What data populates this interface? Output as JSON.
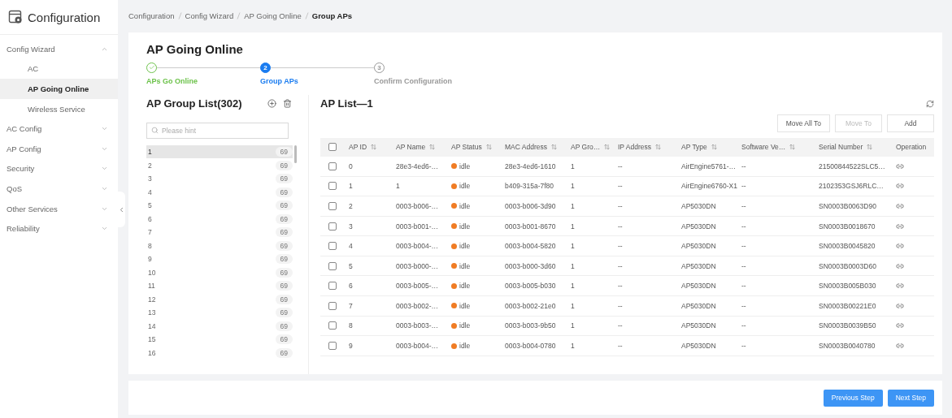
{
  "sidebar": {
    "title": "Configuration",
    "items": [
      {
        "label": "Config Wizard",
        "expanded": true,
        "selected": false,
        "children": [
          {
            "label": "AC",
            "selected": false
          },
          {
            "label": "AP Going Online",
            "selected": true
          },
          {
            "label": "Wireless Service",
            "selected": false
          }
        ]
      },
      {
        "label": "AC Config",
        "expanded": false,
        "selected": false
      },
      {
        "label": "AP Config",
        "expanded": false,
        "selected": false
      },
      {
        "label": "Security",
        "expanded": false,
        "selected": false
      },
      {
        "label": "QoS",
        "expanded": false,
        "selected": false
      },
      {
        "label": "Other Services",
        "expanded": false,
        "selected": false
      },
      {
        "label": "Reliability",
        "expanded": false,
        "selected": false
      }
    ]
  },
  "breadcrumb": [
    {
      "label": "Configuration",
      "current": false
    },
    {
      "label": "Config Wizard",
      "current": false
    },
    {
      "label": "AP Going Online",
      "current": false
    },
    {
      "label": "Group APs",
      "current": true
    }
  ],
  "page_title": "AP Going Online",
  "steps": [
    {
      "label": "APs Go Online",
      "completed": true,
      "selected": false
    },
    {
      "number": "2",
      "label": "Group APs",
      "completed": false,
      "selected": true
    },
    {
      "number": "3",
      "label": "Confirm Configuration",
      "completed": false,
      "selected": false
    }
  ],
  "group_list": {
    "title": "AP Group List(302)",
    "search_placeholder": "Please hint",
    "items": [
      {
        "name": "1",
        "count": "69",
        "selected": true
      },
      {
        "name": "2",
        "count": "69",
        "selected": false
      },
      {
        "name": "3",
        "count": "69",
        "selected": false
      },
      {
        "name": "4",
        "count": "69",
        "selected": false
      },
      {
        "name": "5",
        "count": "69",
        "selected": false
      },
      {
        "name": "6",
        "count": "69",
        "selected": false
      },
      {
        "name": "7",
        "count": "69",
        "selected": false
      },
      {
        "name": "8",
        "count": "69",
        "selected": false
      },
      {
        "name": "9",
        "count": "69",
        "selected": false
      },
      {
        "name": "10",
        "count": "69",
        "selected": false
      },
      {
        "name": "11",
        "count": "69",
        "selected": false
      },
      {
        "name": "12",
        "count": "69",
        "selected": false
      },
      {
        "name": "13",
        "count": "69",
        "selected": false
      },
      {
        "name": "14",
        "count": "69",
        "selected": false
      },
      {
        "name": "15",
        "count": "69",
        "selected": false
      },
      {
        "name": "16",
        "count": "69",
        "selected": false
      }
    ]
  },
  "ap_list": {
    "title": "AP List—1",
    "buttons": [
      {
        "label": "Move All To",
        "disabled": false
      },
      {
        "label": "Move To",
        "disabled": true
      },
      {
        "label": "Add",
        "disabled": false
      }
    ],
    "select_all": {
      "checked": false
    },
    "columns": [
      {
        "label": "AP ID",
        "sortable": true
      },
      {
        "label": "AP Name",
        "sortable": true
      },
      {
        "label": "AP Status",
        "sortable": true
      },
      {
        "label": "MAC Address",
        "sortable": true
      },
      {
        "label": "AP Gro…",
        "sortable": true
      },
      {
        "label": "IP Address",
        "sortable": true
      },
      {
        "label": "AP Type",
        "sortable": true
      },
      {
        "label": "Software Ve…",
        "sortable": true
      },
      {
        "label": "Serial Number",
        "sortable": true
      },
      {
        "label": "Operation",
        "sortable": false
      }
    ],
    "rows": [
      {
        "checked": false,
        "id": "0",
        "name": "28e3-4ed6-…",
        "status": "idle",
        "color": "#f07c24",
        "mac": "28e3-4ed6-1610",
        "group": "1",
        "ip": "--",
        "type": "AirEngine5761-…",
        "software": "--",
        "serial": "21500844522SLC5…"
      },
      {
        "checked": false,
        "id": "1",
        "name": "1",
        "status": "idle",
        "color": "#f07c24",
        "mac": "b409-315a-7f80",
        "group": "1",
        "ip": "--",
        "type": "AirEngine6760-X1",
        "software": "--",
        "serial": "2102353GSJ6RLC…"
      },
      {
        "checked": false,
        "id": "2",
        "name": "0003-b006-…",
        "status": "idle",
        "color": "#f07c24",
        "mac": "0003-b006-3d90",
        "group": "1",
        "ip": "--",
        "type": "AP5030DN",
        "software": "--",
        "serial": "SN0003B0063D90"
      },
      {
        "checked": false,
        "id": "3",
        "name": "0003-b001-…",
        "status": "idle",
        "color": "#f07c24",
        "mac": "0003-b001-8670",
        "group": "1",
        "ip": "--",
        "type": "AP5030DN",
        "software": "--",
        "serial": "SN0003B0018670"
      },
      {
        "checked": false,
        "id": "4",
        "name": "0003-b004-…",
        "status": "idle",
        "color": "#f07c24",
        "mac": "0003-b004-5820",
        "group": "1",
        "ip": "--",
        "type": "AP5030DN",
        "software": "--",
        "serial": "SN0003B0045820"
      },
      {
        "checked": false,
        "id": "5",
        "name": "0003-b000-…",
        "status": "idle",
        "color": "#f07c24",
        "mac": "0003-b000-3d60",
        "group": "1",
        "ip": "--",
        "type": "AP5030DN",
        "software": "--",
        "serial": "SN0003B0003D60"
      },
      {
        "checked": false,
        "id": "6",
        "name": "0003-b005-…",
        "status": "idle",
        "color": "#f07c24",
        "mac": "0003-b005-b030",
        "group": "1",
        "ip": "--",
        "type": "AP5030DN",
        "software": "--",
        "serial": "SN0003B005B030"
      },
      {
        "checked": false,
        "id": "7",
        "name": "0003-b002-…",
        "status": "idle",
        "color": "#f07c24",
        "mac": "0003-b002-21e0",
        "group": "1",
        "ip": "--",
        "type": "AP5030DN",
        "software": "--",
        "serial": "SN0003B00221E0"
      },
      {
        "checked": false,
        "id": "8",
        "name": "0003-b003-…",
        "status": "idle",
        "color": "#f07c24",
        "mac": "0003-b003-9b50",
        "group": "1",
        "ip": "--",
        "type": "AP5030DN",
        "software": "--",
        "serial": "SN0003B0039B50"
      },
      {
        "checked": false,
        "id": "9",
        "name": "0003-b004-…",
        "status": "idle",
        "color": "#f07c24",
        "mac": "0003-b004-0780",
        "group": "1",
        "ip": "--",
        "type": "AP5030DN",
        "software": "--",
        "serial": "SN0003B0040780"
      }
    ]
  },
  "footer_buttons": [
    {
      "label": "Previous Step"
    },
    {
      "label": "Next Step"
    }
  ]
}
